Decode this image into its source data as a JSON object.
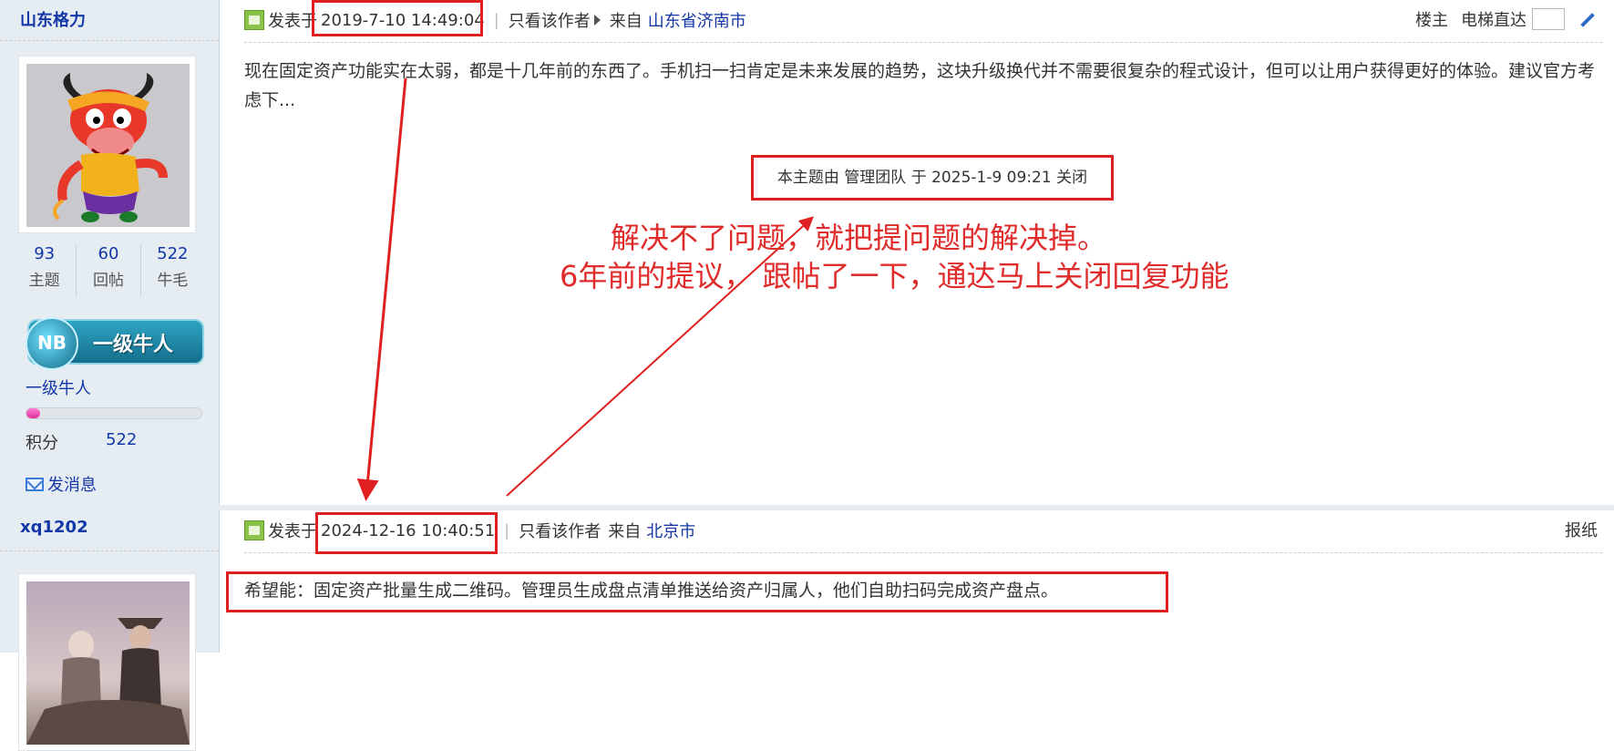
{
  "post1": {
    "author": "山东格力",
    "stats": [
      {
        "num": "93",
        "label": "主题"
      },
      {
        "num": "60",
        "label": "回帖"
      },
      {
        "num": "522",
        "label": "牛毛"
      }
    ],
    "rank_badge_text": "一级牛人",
    "rank_name": "一级牛人",
    "progress": 0.08,
    "points_label": "积分",
    "points_value": "522",
    "message_label": "发消息",
    "posted_label": "发表于",
    "posted_time": "2019-7-10 14:49:04",
    "only_author": "只看该作者",
    "from_label": "来自",
    "location": "山东省济南市",
    "floor": "楼主",
    "elevator": "电梯直达",
    "content": "现在固定资产功能实在太弱，都是十几年前的东西了。手机扫一扫肯定是未来发展的趋势，这块升级换代并不需要很复杂的程式设计，但可以让用户获得更好的体验。建议官方考虑下...",
    "closed_note": "本主题由 管理团队 于 2025-1-9 09:21 关闭"
  },
  "annotation": {
    "line1": "解决不了问题，就把提问题的解决掉。",
    "line2": "6年前的提议，   跟帖了一下，通达马上关闭回复功能",
    "color": "#e02b2b"
  },
  "post2": {
    "author": "xq1202",
    "posted_label": "发表于",
    "posted_time": "2024-12-16 10:40:51",
    "only_author": "只看该作者",
    "from_label": "来自",
    "location": "北京市",
    "report": "报纸",
    "content": "希望能：固定资产批量生成二维码。管理员生成盘点清单推送给资产归属人，他们自助扫码完成资产盘点。"
  },
  "colors": {
    "link": "#1437a8",
    "sidebar": "#e5edf2",
    "highlight": "#e02020"
  }
}
